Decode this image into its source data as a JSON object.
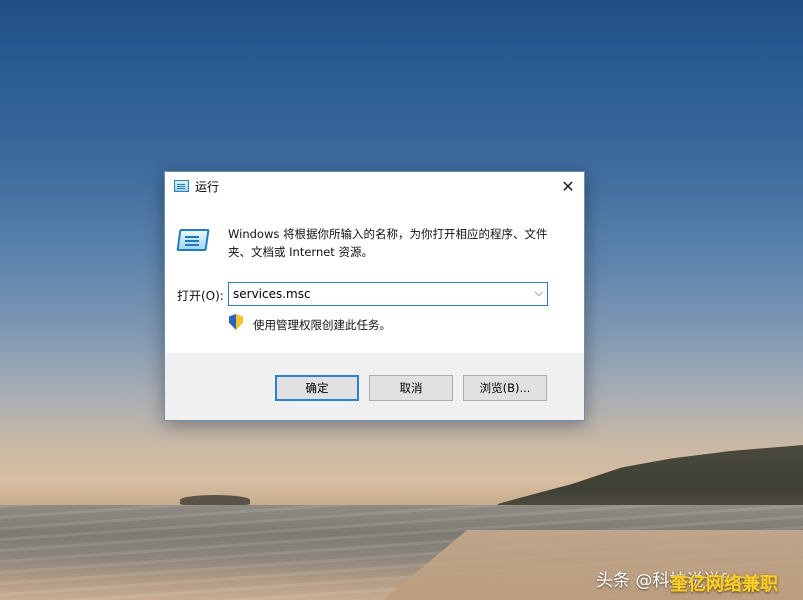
{
  "dialog": {
    "title": "运行",
    "close_glyph": "✕",
    "description": "Windows 将根据你所输入的名称，为你打开相应的程序、文件夹、文档或 Internet 资源。",
    "open_label": "打开(O):",
    "command_value": "services.msc",
    "dropdown_glyph": "⌵",
    "admin_note": "使用管理权限创建此任务。",
    "buttons": {
      "ok": "确定",
      "cancel": "取消",
      "browse": "浏览(B)..."
    }
  },
  "watermark": {
    "text": "头条 @科技说说fang",
    "overlay": "奎亿网络兼职"
  },
  "icons": {
    "run": "run-icon",
    "shield": "uac-shield-icon",
    "close": "close-icon"
  }
}
